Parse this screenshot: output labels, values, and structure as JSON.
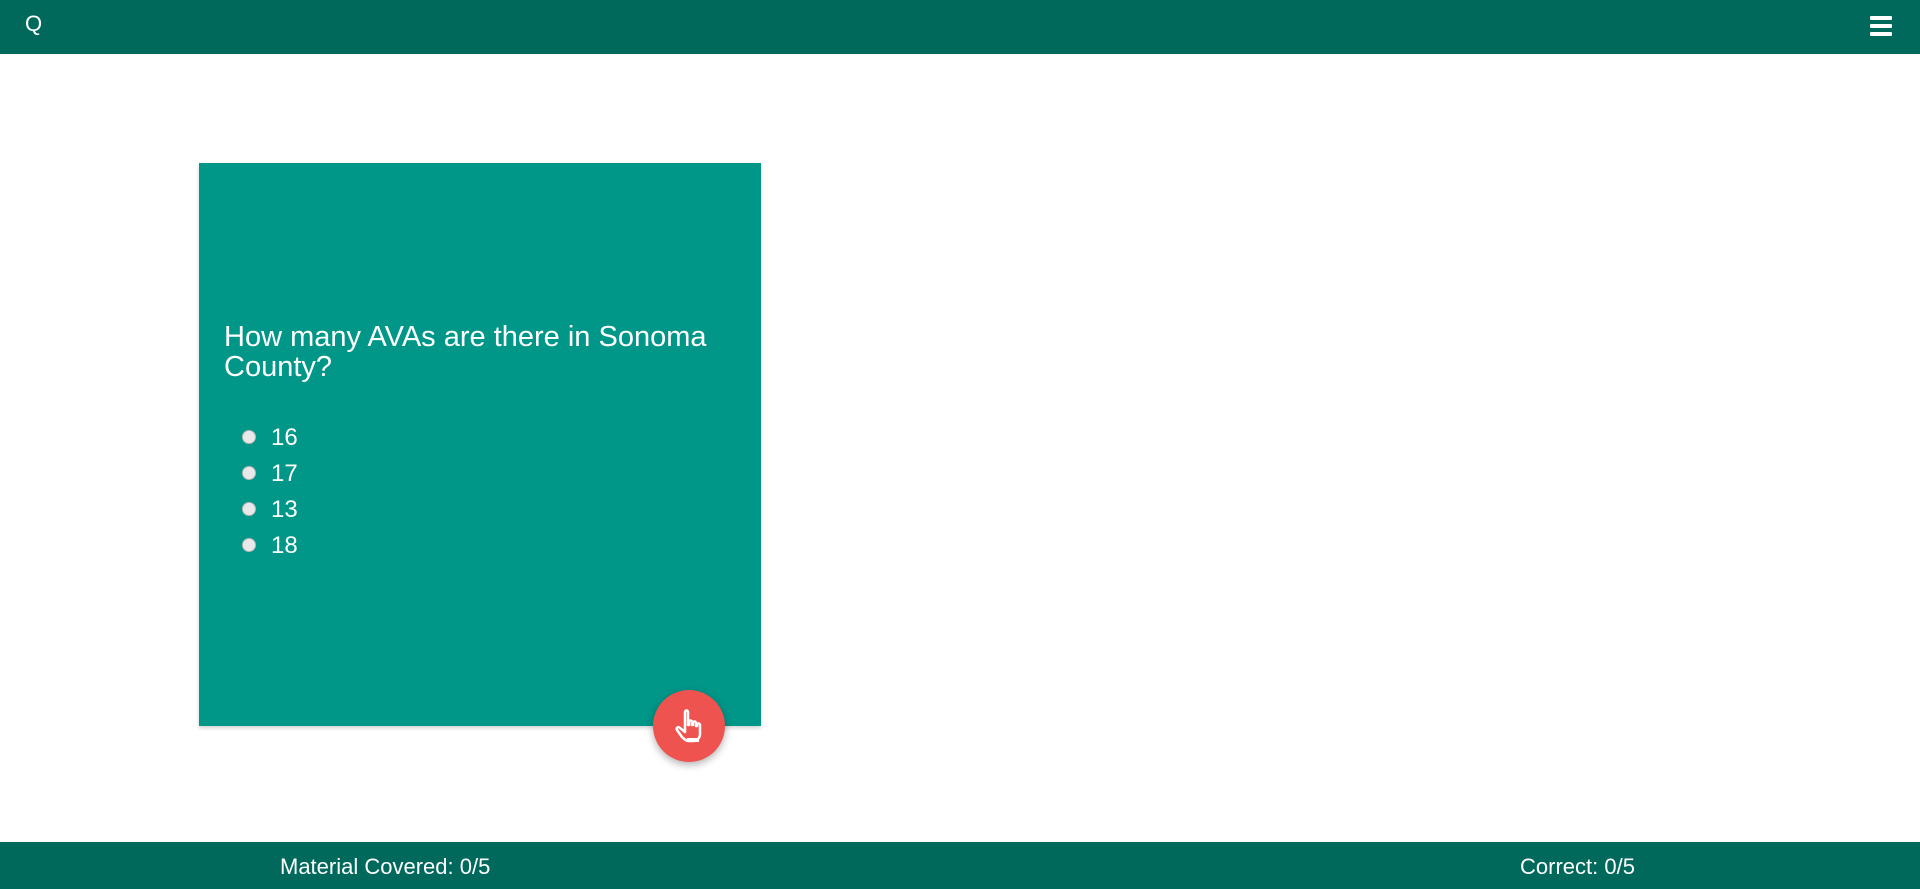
{
  "header": {
    "logo": "Q",
    "menu_icon": "hamburger-menu-icon"
  },
  "quiz": {
    "question": "How many AVAs are there in Sonoma County?",
    "options": [
      "16",
      "17",
      "13",
      "18"
    ],
    "selected": null,
    "submit_icon": "pointing-hand-icon"
  },
  "footer": {
    "material_covered": "Material Covered: 0/5",
    "correct": "Correct: 0/5"
  },
  "colors": {
    "primary_dark": "#00695c",
    "card": "#009688",
    "fab": "#ef5350"
  }
}
